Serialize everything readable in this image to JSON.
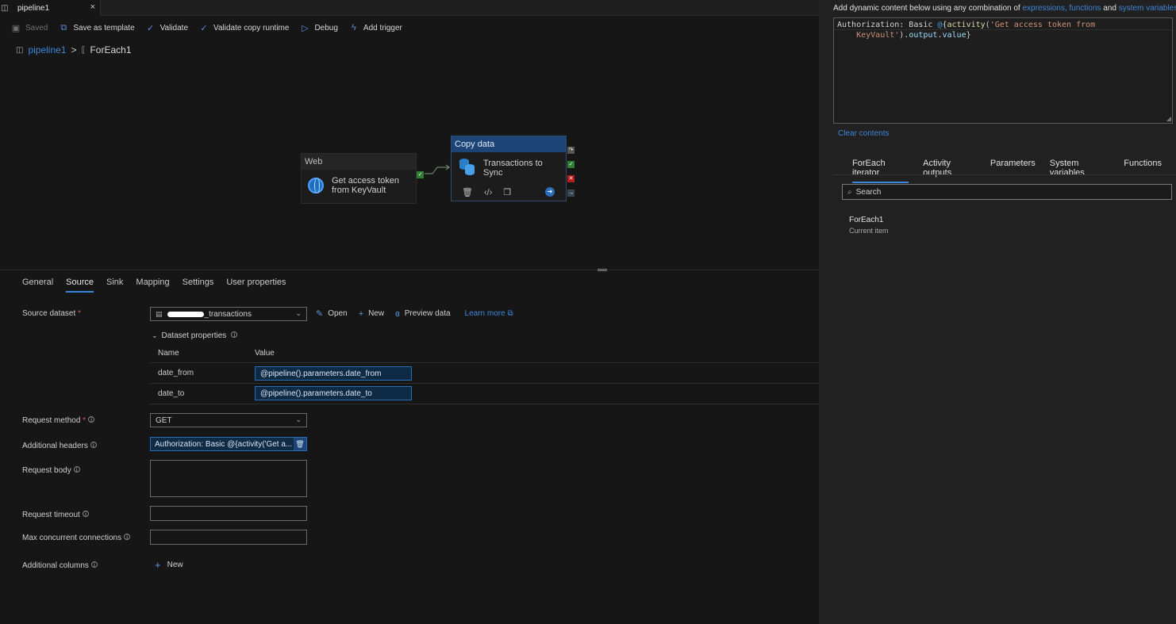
{
  "tab": {
    "label": "pipeline1",
    "close": "×"
  },
  "toolbar": {
    "saved": "Saved",
    "save_template": "Save as template",
    "validate": "Validate",
    "validate_copy": "Validate copy runtime",
    "debug": "Debug",
    "add_trigger": "Add trigger"
  },
  "breadcrumb": {
    "pipeline": "pipeline1",
    "sep": ">",
    "current": "ForEach1"
  },
  "canvas": {
    "web_node": {
      "type": "Web",
      "name": "Get access token from KeyVault"
    },
    "copy_node": {
      "type": "Copy data",
      "name": "Transactions to Sync"
    }
  },
  "props": {
    "tabs": [
      "General",
      "Source",
      "Sink",
      "Mapping",
      "Settings",
      "User properties"
    ],
    "active_tab": "Source",
    "source_dataset_label": "Source dataset",
    "source_dataset_value": "_transactions",
    "open": "Open",
    "new": "New",
    "preview": "Preview data",
    "learn_more": "Learn more",
    "dataset_properties": "Dataset properties",
    "col_name": "Name",
    "col_value": "Value",
    "rows": [
      {
        "name": "date_from",
        "value": "@pipeline().parameters.date_from"
      },
      {
        "name": "date_to",
        "value": "@pipeline().parameters.date_to"
      }
    ],
    "request_method_label": "Request method",
    "request_method_value": "GET",
    "additional_headers_label": "Additional headers",
    "additional_headers_value": "Authorization: Basic @{activity('Get a...",
    "request_body_label": "Request body",
    "request_timeout_label": "Request timeout",
    "max_conn_label": "Max concurrent connections",
    "additional_columns_label": "Additional columns",
    "new_column": "New"
  },
  "panel": {
    "intro": "Add dynamic content below using any combination of",
    "link_expressions": "expressions, functions",
    "and": "and",
    "link_sysvars": "system variables.",
    "clear": "Clear contents",
    "tabs": [
      "ForEach iterator",
      "Activity outputs",
      "Parameters",
      "System variables",
      "Functions"
    ],
    "search_placeholder": "Search",
    "item_title": "ForEach1",
    "item_sub": "Current item"
  },
  "editor": {
    "line1_pre": "Authorization: Basic ",
    "line1_at": "@",
    "line1_brace": "{",
    "line1_fn": "activity",
    "line1_open": "(",
    "line1_str": "'Get access token from",
    "line2_indent": "    ",
    "line2_str": "KeyVault'",
    "line2_close": ").",
    "line2_prop1": "output",
    "line2_dot": ".",
    "line2_prop2": "value",
    "line2_end": "}"
  },
  "colors": {
    "accent": "#3a86d8",
    "copy_header": "#1d4477"
  }
}
